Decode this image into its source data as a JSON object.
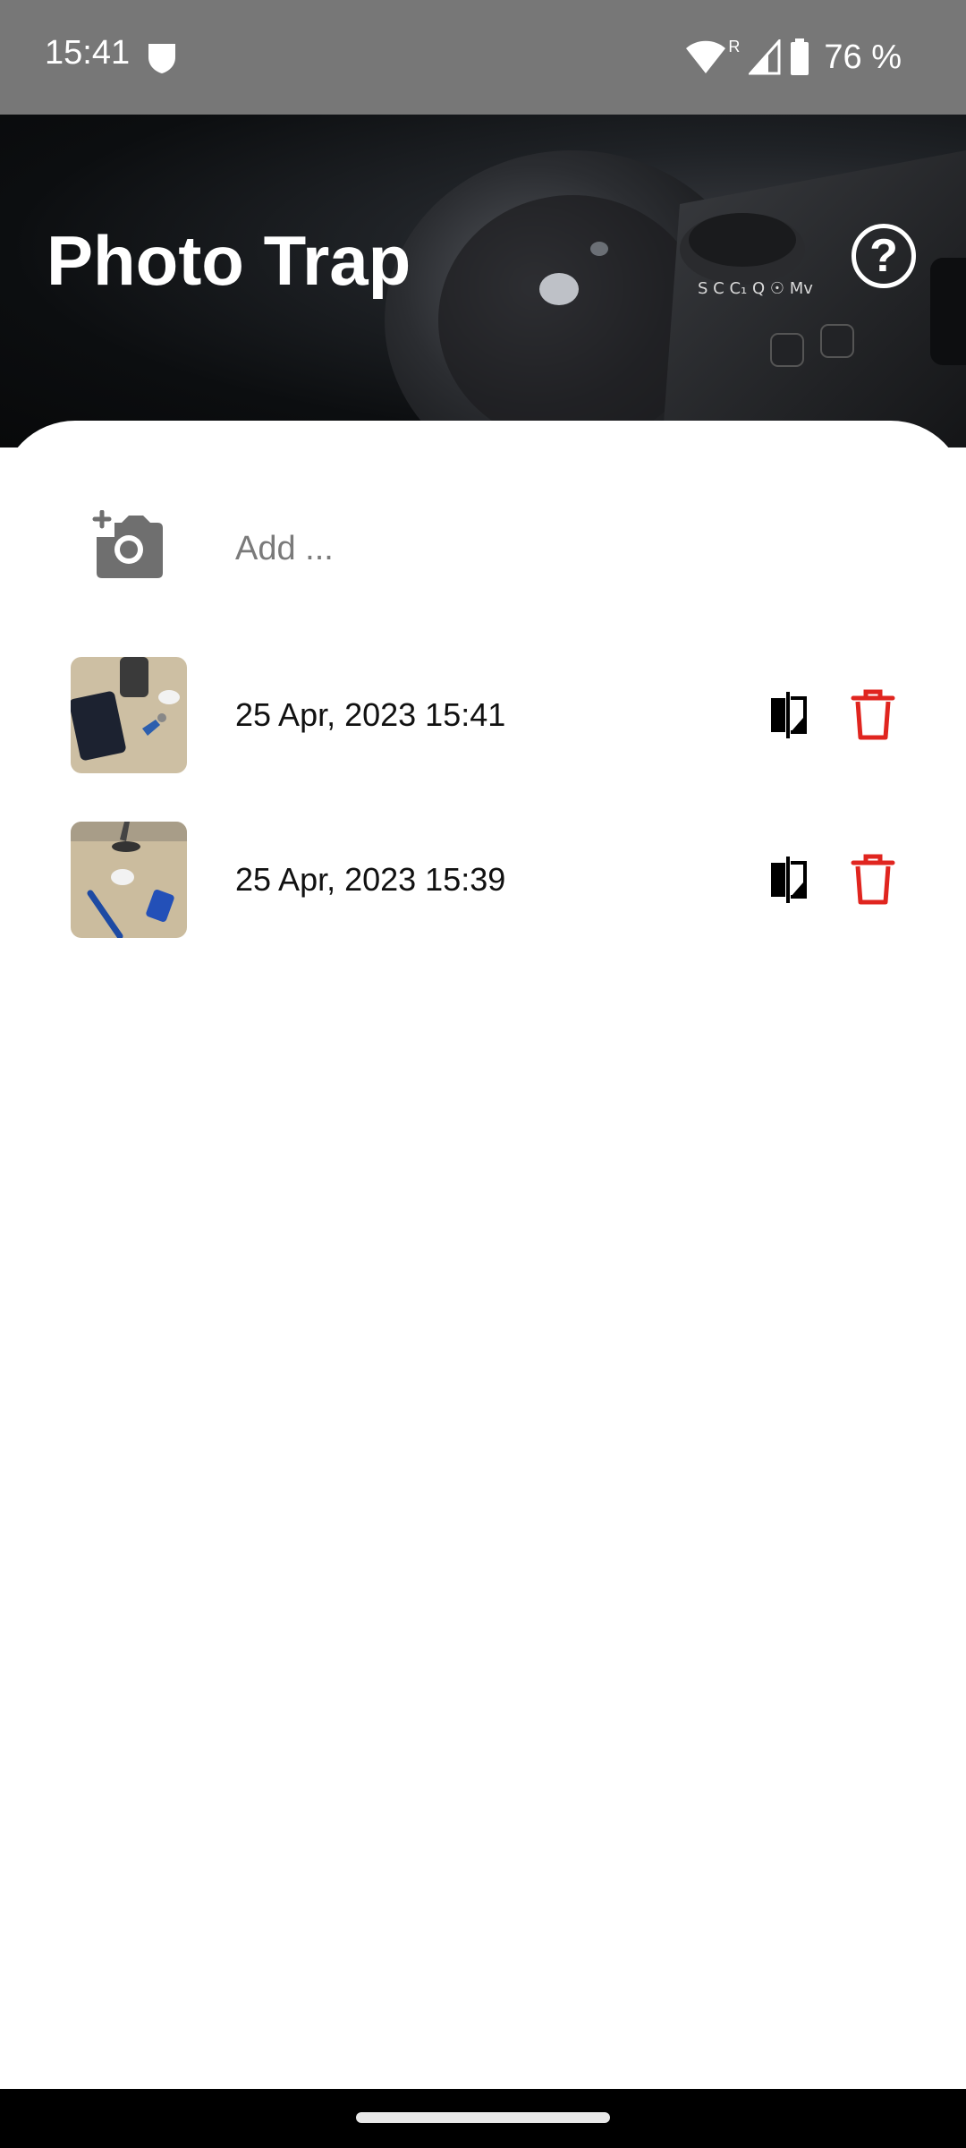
{
  "status_bar": {
    "time": "15:41",
    "shield_icon": "shield-icon",
    "wifi_icon": "wifi-icon",
    "roaming_label": "R",
    "signal_icon": "signal-icon",
    "battery_icon": "battery-icon",
    "battery_text": "76 %"
  },
  "header": {
    "title": "Photo Trap",
    "help_icon": "help-circle-icon",
    "help_glyph": "?"
  },
  "add_row": {
    "icon": "add-camera-icon",
    "label": "Add ..."
  },
  "items": [
    {
      "date": "25 Apr, 2023 15:41",
      "compare_icon": "compare-icon",
      "delete_icon": "trash-icon"
    },
    {
      "date": "25 Apr, 2023 15:39",
      "compare_icon": "compare-icon",
      "delete_icon": "trash-icon"
    }
  ],
  "colors": {
    "status_bar": "#777777",
    "delete": "#e0251f",
    "add_icon": "#6f6f6f",
    "text": "#111111",
    "muted": "#7a7a7a"
  }
}
